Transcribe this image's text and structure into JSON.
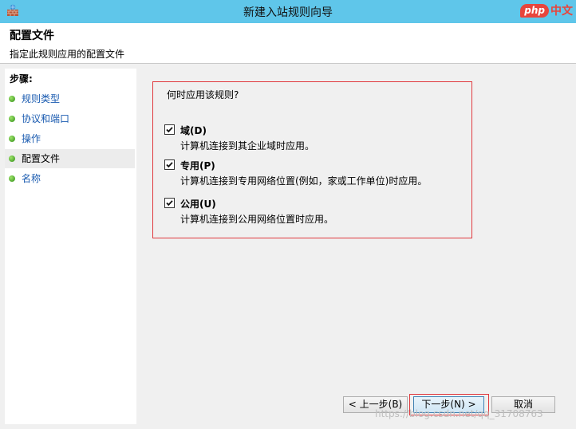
{
  "window": {
    "title": "新建入站规则向导",
    "brand_php": "php",
    "brand_cn": "中文"
  },
  "header": {
    "title": "配置文件",
    "subtitle": "指定此规则应用的配置文件"
  },
  "sidebar": {
    "steps_title": "步骤:",
    "items": [
      {
        "label": "规则类型"
      },
      {
        "label": "协议和端口"
      },
      {
        "label": "操作"
      },
      {
        "label": "配置文件"
      },
      {
        "label": "名称"
      }
    ],
    "active_index": 3
  },
  "main": {
    "question": "何时应用该规则?",
    "options": [
      {
        "title": "域(D)",
        "desc": "计算机连接到其企业域时应用。",
        "checked": true
      },
      {
        "title": "专用(P)",
        "desc": "计算机连接到专用网络位置(例如，家或工作单位)时应用。",
        "checked": true
      },
      {
        "title": "公用(U)",
        "desc": "计算机连接到公用网络位置时应用。",
        "checked": true
      }
    ]
  },
  "buttons": {
    "back": "< 上一步(B)",
    "next": "下一步(N) >",
    "cancel": "取消"
  },
  "watermark": "https://blog.csdn.net/qq_31708763",
  "colors": {
    "titlebar": "#5fc6ea",
    "highlight_border": "#e0393e",
    "link": "#1a5bb0"
  }
}
